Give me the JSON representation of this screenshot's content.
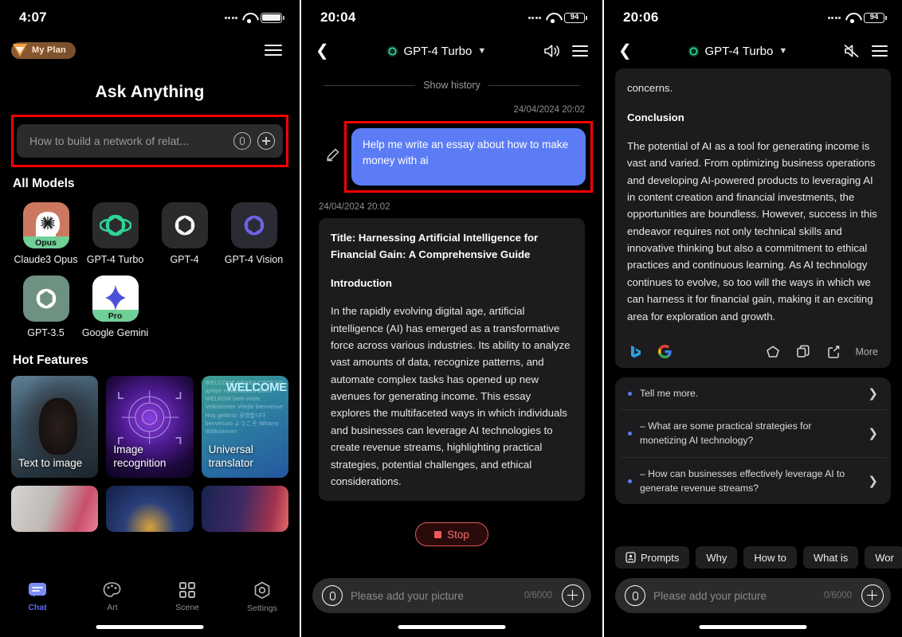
{
  "panel1": {
    "status": {
      "time": "4:07",
      "battery_icon": "battery-full-icon"
    },
    "plan_badge": "My Plan",
    "menu_icon": "hamburger-menu-icon",
    "title": "Ask Anything",
    "search": {
      "placeholder": "How to build a network of relat...",
      "mic_icon": "mic-icon",
      "plus_icon": "plus-icon"
    },
    "models_heading": "All Models",
    "models": [
      {
        "label": "Claude3 Opus",
        "tag": "Opus",
        "icon": "claude-opus-icon"
      },
      {
        "label": "GPT-4 Turbo",
        "tag": "",
        "icon": "openai-icon"
      },
      {
        "label": "GPT-4",
        "tag": "",
        "icon": "openai-icon"
      },
      {
        "label": "GPT-4 Vision",
        "tag": "",
        "icon": "openai-icon"
      },
      {
        "label": "GPT-3.5",
        "tag": "",
        "icon": "openai-icon"
      },
      {
        "label": "Google Gemini",
        "tag": "Pro",
        "icon": "gemini-icon"
      }
    ],
    "features_heading": "Hot Features",
    "features": [
      {
        "caption": "Text to image"
      },
      {
        "caption": "Image recognition"
      },
      {
        "caption": "Universal translator"
      }
    ],
    "tabs": [
      {
        "label": "Chat",
        "icon": "chat-icon",
        "active": true
      },
      {
        "label": "Art",
        "icon": "palette-icon",
        "active": false
      },
      {
        "label": "Scene",
        "icon": "grid-icon",
        "active": false
      },
      {
        "label": "Settings",
        "icon": "settings-icon",
        "active": false
      }
    ]
  },
  "panel2": {
    "status": {
      "time": "20:04",
      "battery": "94"
    },
    "nav": {
      "back_icon": "back-chevron-icon",
      "model": "GPT-4 Turbo",
      "chevron": "⌄",
      "speaker_icon": "speaker-on-icon",
      "menu_icon": "hamburger-menu-icon"
    },
    "show_history": "Show history",
    "user_timestamp": "24/04/2024 20:02",
    "user_message": "Help me write an essay about how to make money with ai",
    "edit_icon": "pencil-icon",
    "ai_timestamp": "24/04/2024 20:02",
    "ai_title": "Title: Harnessing Artificial Intelligence for Financial Gain: A Comprehensive Guide",
    "ai_heading": "Introduction",
    "ai_body": "In the rapidly evolving digital age, artificial intelligence (AI) has emerged as a transformative force across various industries. Its ability to analyze vast amounts of data, recognize patterns, and automate complex tasks has opened up new avenues for generating income. This essay explores the multifaceted ways in which individuals and businesses can leverage AI technologies to create revenue streams, highlighting practical strategies, potential challenges, and ethical considerations.",
    "stop_label": "Stop",
    "composer": {
      "placeholder": "Please add your picture",
      "counter": "0/6000",
      "mic_icon": "mic-icon",
      "plus_icon": "plus-icon"
    }
  },
  "panel3": {
    "status": {
      "time": "20:06",
      "battery": "94"
    },
    "nav": {
      "back_icon": "back-chevron-icon",
      "model": "GPT-4 Turbo",
      "chevron": "⌄",
      "speaker_icon": "speaker-muted-icon",
      "menu_icon": "hamburger-menu-icon"
    },
    "ai_tail": "concerns.",
    "ai_heading": "Conclusion",
    "ai_body": "The potential of AI as a tool for generating income is vast and varied. From optimizing business operations and developing AI-powered products to leveraging AI in content creation and financial investments, the opportunities are boundless. However, success in this endeavor requires not only technical skills and innovative thinking but also a commitment to ethical practices and continuous learning. As AI technology continues to evolve, so too will the ways in which we can harness it for financial gain, making it an exciting area for exploration and growth.",
    "actions": {
      "bing_icon": "bing-icon",
      "google_icon": "google-icon",
      "favorite_icon": "pentagon-favorite-icon",
      "copy_icon": "copy-icon",
      "share_icon": "share-icon",
      "more_label": "More"
    },
    "suggestions": [
      "Tell me more.",
      "– What are some practical strategies for monetizing AI technology?",
      "– How can businesses effectively leverage AI to generate revenue streams?"
    ],
    "chips": [
      {
        "label": "Prompts",
        "icon": "prompts-icon"
      },
      {
        "label": "Why",
        "icon": ""
      },
      {
        "label": "How to",
        "icon": ""
      },
      {
        "label": "What is",
        "icon": ""
      },
      {
        "label": "Wor",
        "icon": ""
      }
    ],
    "composer": {
      "placeholder": "Please add your picture",
      "counter": "0/6000",
      "mic_icon": "mic-icon",
      "plus_icon": "plus-icon"
    }
  },
  "colors": {
    "accent_blue": "#5b7cf5",
    "highlight_red": "#ff0000",
    "bubble_blue": "#5b7cf5",
    "panel_bg": "#000000",
    "card_bg": "#1c1c1e",
    "stop_red": "#f07070"
  }
}
